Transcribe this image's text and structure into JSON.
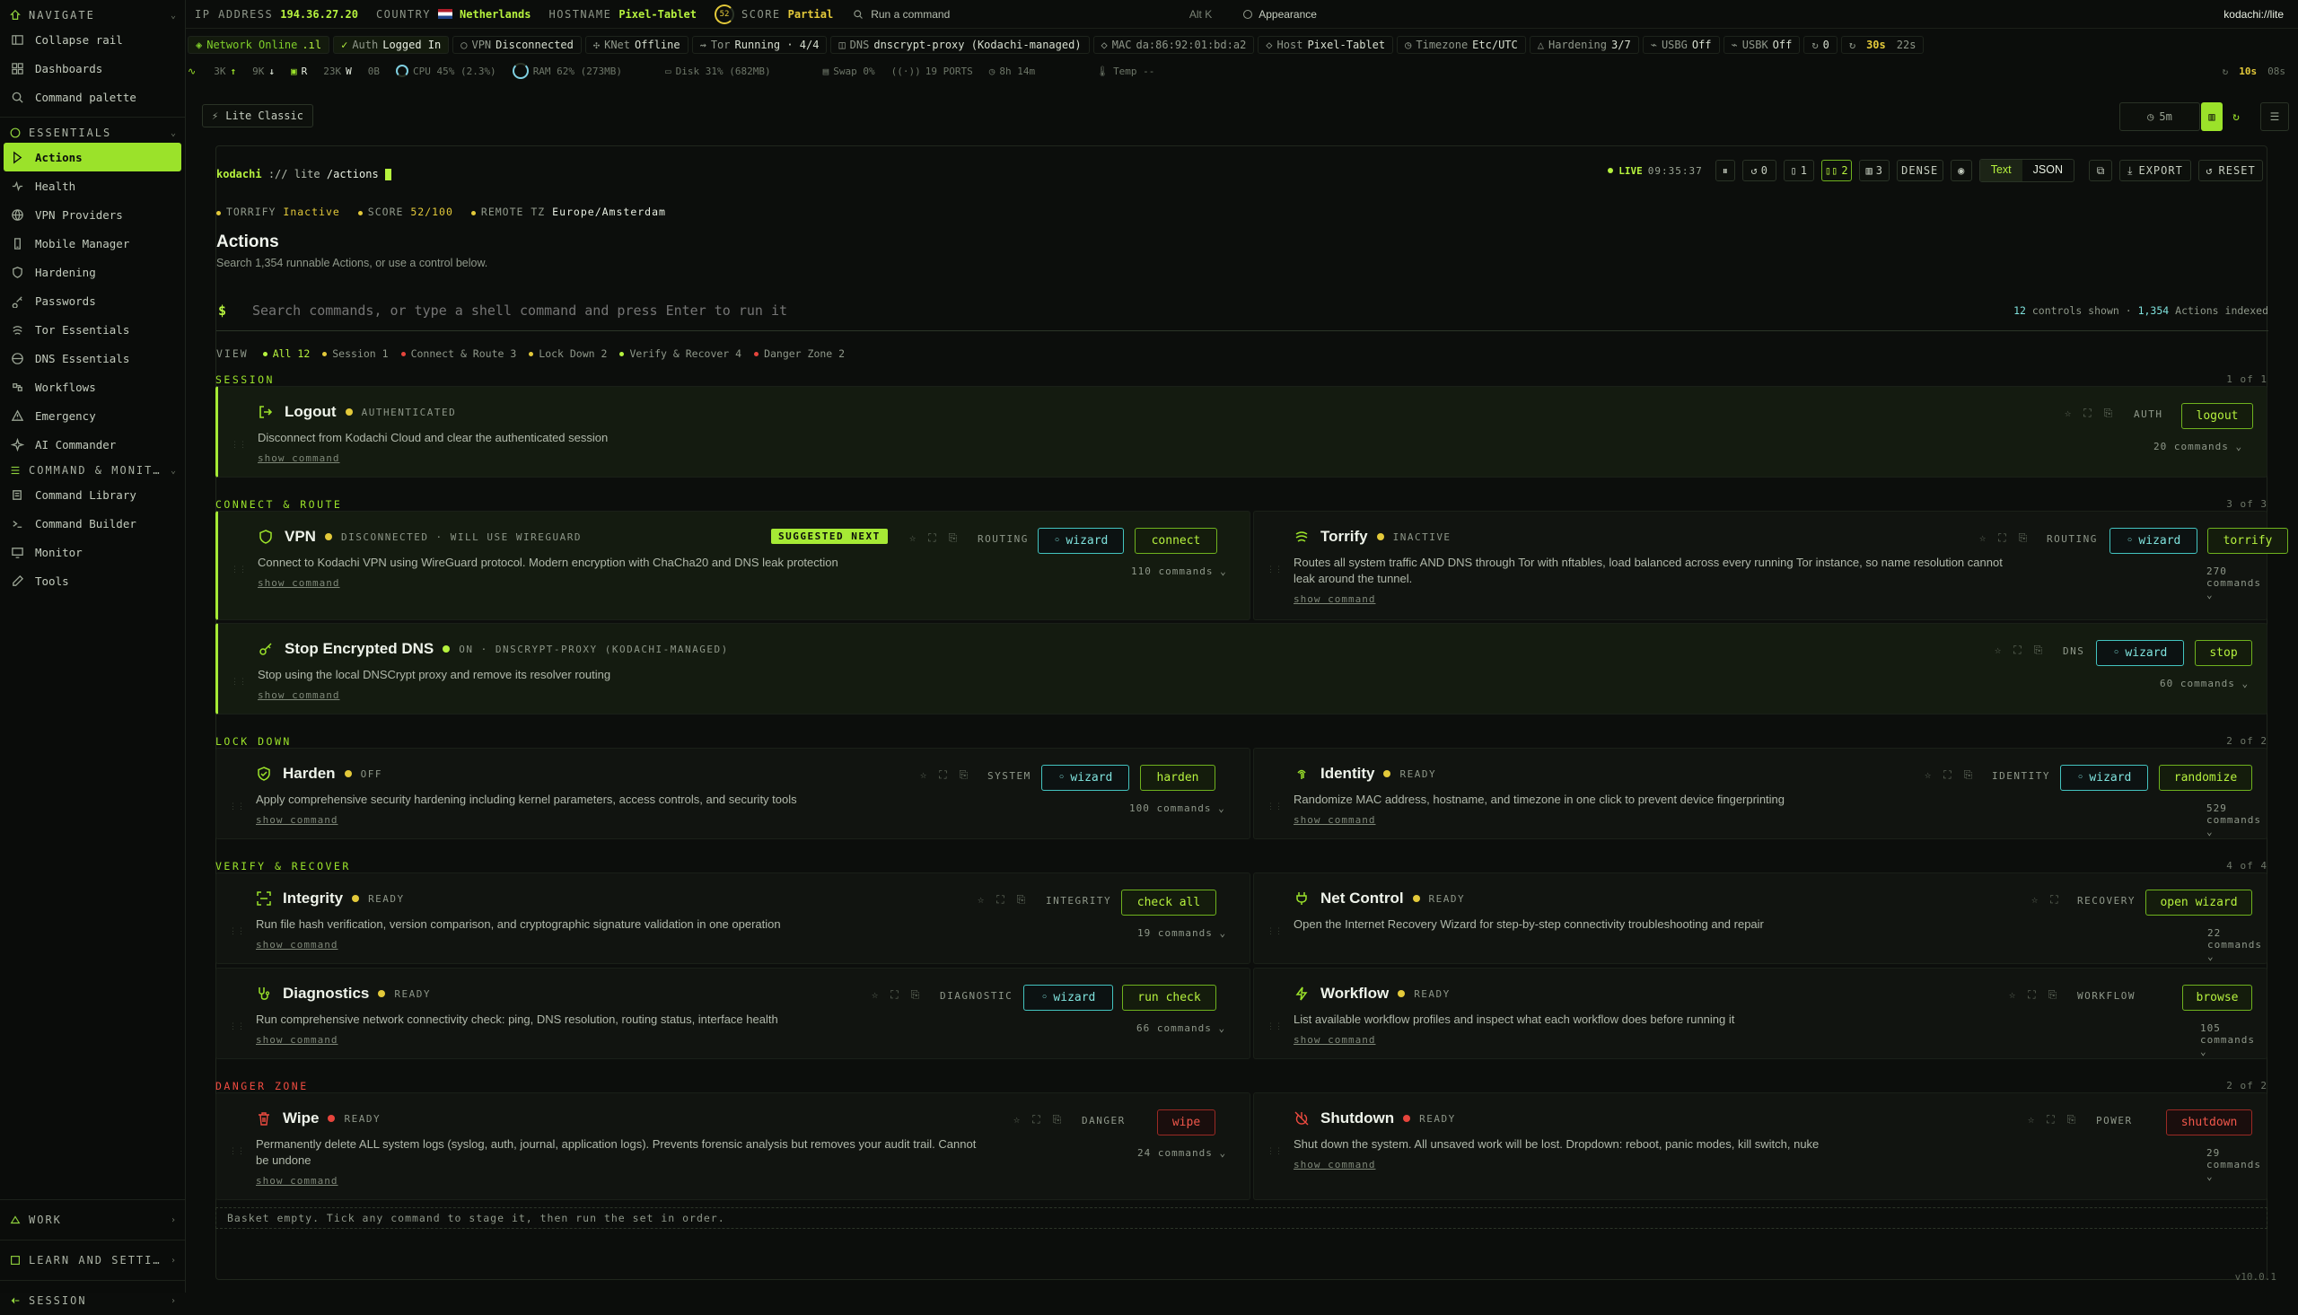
{
  "sidebar": {
    "navigate_label": "NAVIGATE",
    "collapse": "Collapse rail",
    "dashboards": "Dashboards",
    "palette": "Command palette",
    "essentials_label": "ESSENTIALS",
    "essentials": [
      "Actions",
      "Health",
      "VPN Providers",
      "Mobile Manager",
      "Hardening",
      "Passwords",
      "Tor Essentials",
      "DNS Essentials",
      "Workflows",
      "Emergency",
      "AI Commander"
    ],
    "cm_label": "COMMAND & MONIT…",
    "cm": [
      "Command Library",
      "Command Builder",
      "Monitor",
      "Tools"
    ],
    "work": "WORK",
    "learn": "LEARN AND SETTI…",
    "session": "SESSION"
  },
  "topbar": {
    "ip_label": "IP ADDRESS",
    "ip": "194.36.27.20",
    "country_label": "COUNTRY",
    "country": "Netherlands",
    "host_label": "HOSTNAME",
    "host": "Pixel-Tablet",
    "score_num": "52",
    "score_label": "SCORE",
    "score": "Partial",
    "run_cmd": "Run a command",
    "shortcut": "Alt K",
    "appearance": "Appearance",
    "brand": "kodachi://lite"
  },
  "status": {
    "network": "Network Online",
    "auth_k": "Auth",
    "auth": "Logged In",
    "vpn_k": "VPN",
    "vpn": "Disconnected",
    "knet_k": "KNet",
    "knet": "Offline",
    "tor_k": "Tor",
    "tor": "Running · 4/4",
    "dns_k": "DNS",
    "dns": "dnscrypt-proxy (Kodachi-managed)",
    "mac_k": "MAC",
    "mac": "da:86:92:01:bd:a2",
    "hostk": "Host",
    "hostv": "Pixel-Tablet",
    "tz_k": "Timezone",
    "tz": "Etc/UTC",
    "hard_k": "Hardening",
    "hard": "3/7",
    "usbg_k": "USBG",
    "usbg": "Off",
    "usbk_k": "USBK",
    "usbk": "Off",
    "count": "0",
    "t30": "30s",
    "t22": "22s"
  },
  "metrics": {
    "up": "3K",
    "down": "9K",
    "r": "R",
    "r_val": "23K",
    "w": "W",
    "w_val": "0B",
    "cpu": "CPU 45% (2.3%)",
    "ram": "RAM 62% (273MB)",
    "disk": "Disk 31% (682MB)",
    "swap": "Swap 0%",
    "ports": "19 PORTS",
    "uptime": "8h 14m",
    "temp": "Temp --",
    "t10": "10s",
    "t08": "08s"
  },
  "subbar": {
    "lite": "Lite Classic",
    "timer": "5m"
  },
  "panel": {
    "crumb_a": "kodachi",
    "crumb_b": "://",
    "crumb_c": "lite",
    "crumb_d": "/actions",
    "live": "LIVE",
    "time": "09:35:37",
    "h0": "0",
    "h1": "1",
    "h2": "2",
    "h3": "3",
    "dense": "DENSE",
    "text": "Text",
    "json": "JSON",
    "export": "EXPORT",
    "reset": "RESET",
    "torrify_k": "TORRIFY",
    "torrify": "Inactive",
    "score_k": "SCORE",
    "score": "52/100",
    "tz_k": "REMOTE TZ",
    "tz": "Europe/Amsterdam",
    "title": "Actions",
    "subtitle": "Search 1,354 runnable Actions, or use a control below.",
    "prompt": "$",
    "search_placeholder": "Search commands, or type a shell command and press Enter to run it",
    "shown_a": "12",
    "shown_b": "controls shown ·",
    "shown_c": "1,354",
    "shown_d": "Actions indexed",
    "view": "VIEW",
    "filters": [
      "All 12",
      "Session 1",
      "Connect & Route 3",
      "Lock Down 2",
      "Verify & Recover 4",
      "Danger Zone 2"
    ],
    "filter_colors": [
      "#b6f23e",
      "#e3c93a",
      "#e6453c",
      "#e3c93a",
      "#b6f23e",
      "#e6453c"
    ],
    "sections": {
      "session": "SESSION",
      "session_n": "1 of 1",
      "connect": "CONNECT & ROUTE",
      "connect_n": "3 of 3",
      "lock": "LOCK DOWN",
      "lock_n": "2 of 2",
      "verify": "VERIFY & RECOVER",
      "verify_n": "4 of 4",
      "danger": "DANGER ZONE",
      "danger_n": "2 of 2"
    },
    "basket": "Basket empty. Tick any command to stage it, then run the set in order.",
    "version": "v10.0.1"
  },
  "cards": {
    "logout": {
      "title": "Logout",
      "status": "AUTHENTICATED",
      "desc": "Disconnect from Kodachi Cloud and clear the authenticated session",
      "show": "show command",
      "tag": "AUTH",
      "primary": "logout",
      "cmds": "20 commands ⌄"
    },
    "vpn": {
      "title": "VPN",
      "status": "DISCONNECTED · WILL USE WIREGUARD",
      "sugg": "SUGGESTED NEXT",
      "desc": "Connect to Kodachi VPN using WireGuard protocol. Modern encryption with ChaCha20 and DNS leak protection",
      "show": "show command",
      "tag": "ROUTING",
      "wizard": "wizard",
      "primary": "connect",
      "cmds": "110 commands ⌄"
    },
    "torrify": {
      "title": "Torrify",
      "status": "INACTIVE",
      "desc1": "Routes all system traffic AND DNS through Tor with nftables, load balanced across every running Tor instance, so name resolution cannot",
      "desc2": "leak around the tunnel.",
      "show": "show command",
      "tag": "ROUTING",
      "wizard": "wizard",
      "primary": "torrify",
      "cmds": "270 commands ⌄"
    },
    "dns": {
      "title": "Stop Encrypted DNS",
      "status": "ON · DNSCRYPT-PROXY (KODACHI-MANAGED)",
      "desc": "Stop using the local DNSCrypt proxy and remove its resolver routing",
      "show": "show command",
      "tag": "DNS",
      "wizard": "wizard",
      "primary": "stop",
      "cmds": "60 commands ⌄"
    },
    "harden": {
      "title": "Harden",
      "status": "OFF",
      "desc": "Apply comprehensive security hardening including kernel parameters, access controls, and security tools",
      "show": "show command",
      "tag": "SYSTEM",
      "wizard": "wizard",
      "primary": "harden",
      "cmds": "100 commands ⌄"
    },
    "identity": {
      "title": "Identity",
      "status": "READY",
      "desc": "Randomize MAC address, hostname, and timezone in one click to prevent device fingerprinting",
      "show": "show command",
      "tag": "IDENTITY",
      "wizard": "wizard",
      "primary": "randomize",
      "cmds": "529 commands ⌄"
    },
    "integrity": {
      "title": "Integrity",
      "status": "READY",
      "desc": "Run file hash verification, version comparison, and cryptographic signature validation in one operation",
      "show": "show command",
      "tag": "INTEGRITY",
      "primary": "check all",
      "cmds": "19 commands ⌄"
    },
    "netcontrol": {
      "title": "Net Control",
      "status": "READY",
      "desc": "Open the Internet Recovery Wizard for step-by-step connectivity troubleshooting and repair",
      "tag": "RECOVERY",
      "primary": "open wizard",
      "cmds": "22 commands ⌄"
    },
    "diagnostics": {
      "title": "Diagnostics",
      "status": "READY",
      "desc": "Run comprehensive network connectivity check: ping, DNS resolution, routing status, interface health",
      "show": "show command",
      "tag": "DIAGNOSTIC",
      "wizard": "wizard",
      "primary": "run check",
      "cmds": "66 commands ⌄"
    },
    "workflow": {
      "title": "Workflow",
      "status": "READY",
      "desc": "List available workflow profiles and inspect what each workflow does before running it",
      "show": "show command",
      "tag": "WORKFLOW",
      "primary": "browse",
      "cmds": "105 commands ⌄"
    },
    "wipe": {
      "title": "Wipe",
      "status": "READY",
      "desc1": "Permanently delete ALL system logs (syslog, auth, journal, application logs). Prevents forensic analysis but removes your audit trail. Cannot",
      "desc2": "be undone",
      "show": "show command",
      "tag": "DANGER",
      "primary": "wipe",
      "cmds": "24 commands ⌄"
    },
    "shutdown": {
      "title": "Shutdown",
      "status": "READY",
      "desc": "Shut down the system. All unsaved work will be lost. Dropdown: reboot, panic modes, kill switch, nuke",
      "show": "show command",
      "tag": "POWER",
      "primary": "shutdown",
      "cmds": "29 commands ⌄"
    }
  }
}
